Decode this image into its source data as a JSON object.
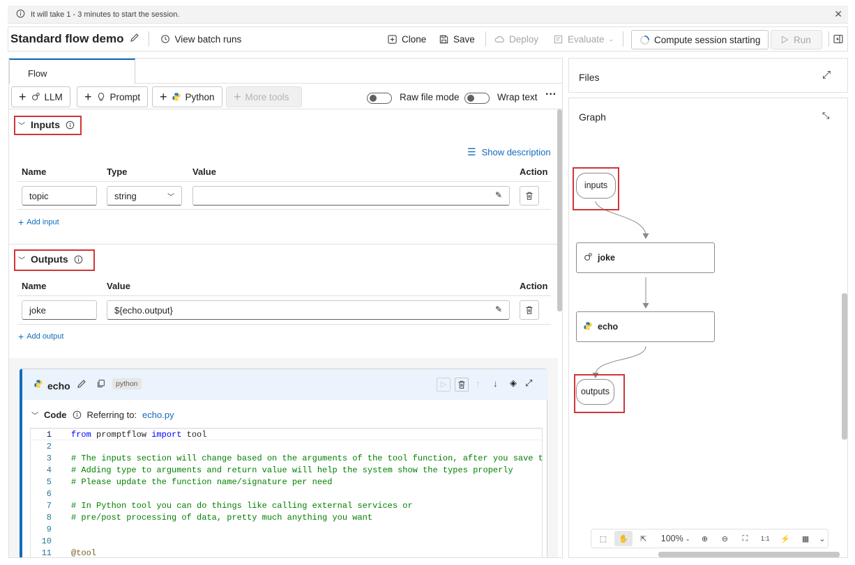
{
  "banner": {
    "text": "It will take 1 - 3 minutes to start the session."
  },
  "toolbar": {
    "title": "Standard flow demo",
    "view_batch_runs": "View batch runs",
    "clone": "Clone",
    "save": "Save",
    "deploy": "Deploy",
    "evaluate": "Evaluate",
    "compute_status": "Compute session starting",
    "run": "Run"
  },
  "flow": {
    "tab_label": "Flow",
    "buttons": {
      "llm": "LLM",
      "prompt": "Prompt",
      "python": "Python",
      "more_tools": "More tools"
    },
    "raw_file_mode": "Raw file mode",
    "wrap_text": "Wrap text"
  },
  "inputs": {
    "heading": "Inputs",
    "show_description": "Show description",
    "columns": {
      "name": "Name",
      "type": "Type",
      "value": "Value",
      "action": "Action"
    },
    "rows": [
      {
        "name": "topic",
        "type": "string",
        "value": ""
      }
    ],
    "add_label": "Add input"
  },
  "outputs": {
    "heading": "Outputs",
    "columns": {
      "name": "Name",
      "value": "Value",
      "action": "Action"
    },
    "rows": [
      {
        "name": "joke",
        "value": "${echo.output}"
      }
    ],
    "add_label": "Add output"
  },
  "node": {
    "name": "echo",
    "badge": "python",
    "code_label": "Code",
    "referring_label": "Referring to:",
    "file": "echo.py"
  },
  "code_lines": [
    {
      "n": "1",
      "segments": [
        {
          "t": "from",
          "c": "kw"
        },
        {
          "t": " promptflow ",
          "c": ""
        },
        {
          "t": "import",
          "c": "kw"
        },
        {
          "t": " tool",
          "c": ""
        }
      ]
    },
    {
      "n": "2",
      "segments": []
    },
    {
      "n": "3",
      "segments": [
        {
          "t": "# The inputs section will change based on the arguments of the tool function, after you save the",
          "c": "cm"
        }
      ]
    },
    {
      "n": "4",
      "segments": [
        {
          "t": "# Adding type to arguments and return value will help the system show the types properly",
          "c": "cm"
        }
      ]
    },
    {
      "n": "5",
      "segments": [
        {
          "t": "# Please update the function name/signature per need",
          "c": "cm"
        }
      ]
    },
    {
      "n": "6",
      "segments": []
    },
    {
      "n": "7",
      "segments": [
        {
          "t": "# In Python tool you can do things like calling external services or",
          "c": "cm"
        }
      ]
    },
    {
      "n": "8",
      "segments": [
        {
          "t": "# pre/post processing of data, pretty much anything you want",
          "c": "cm"
        }
      ]
    },
    {
      "n": "9",
      "segments": []
    },
    {
      "n": "10",
      "segments": []
    },
    {
      "n": "11",
      "segments": [
        {
          "t": "@tool",
          "c": "dc"
        }
      ]
    }
  ],
  "files": {
    "heading": "Files"
  },
  "graph": {
    "heading": "Graph",
    "nodes": {
      "inputs": "inputs",
      "joke": "joke",
      "echo": "echo",
      "outputs": "outputs"
    },
    "zoom": "100%"
  },
  "colors": {
    "accent": "#0f6cbd",
    "highlight": "#d13438",
    "python_blue": "#3776ab",
    "python_yellow": "#ffd43b"
  }
}
